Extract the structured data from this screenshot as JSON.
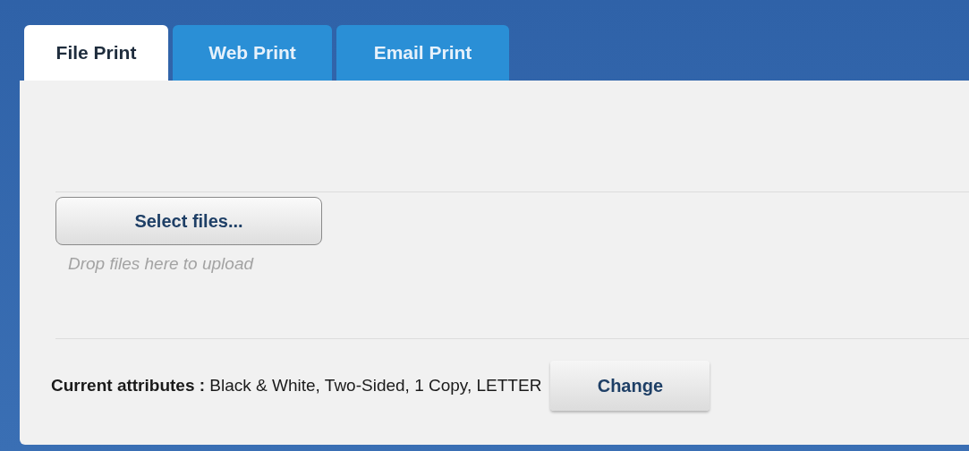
{
  "tabs": [
    {
      "label": "File Print",
      "selected": true
    },
    {
      "label": "Web Print",
      "selected": false
    },
    {
      "label": "Email Print",
      "selected": false
    }
  ],
  "upload": {
    "button": "Select files...",
    "hint": "Drop files here to upload"
  },
  "attributes": {
    "label": "Current attributes :",
    "value": "Black & White, Two-Sided, 1 Copy, LETTER",
    "button": "Change"
  }
}
